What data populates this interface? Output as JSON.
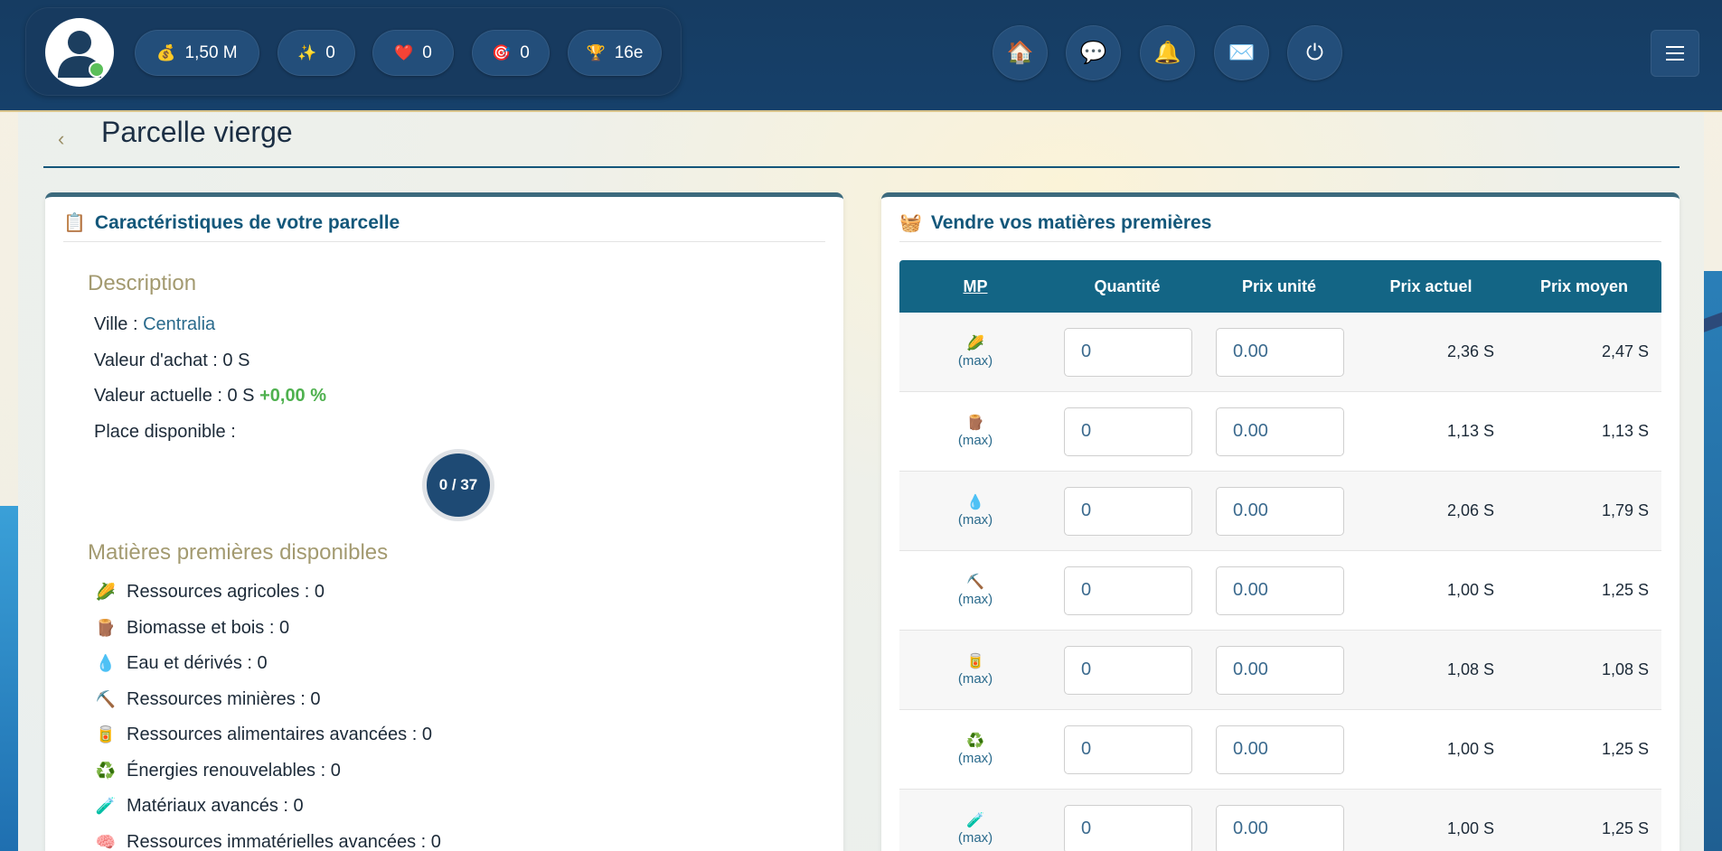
{
  "stats": [
    {
      "icon": "money-bag-icon",
      "glyph": "💰",
      "value": "1,50 M"
    },
    {
      "icon": "sparkles-icon",
      "glyph": "✨",
      "value": "0"
    },
    {
      "icon": "heart-icon",
      "glyph": "❤️",
      "value": "0"
    },
    {
      "icon": "target-icon",
      "glyph": "🎯",
      "value": "0"
    },
    {
      "icon": "trophy-icon",
      "glyph": "🏆",
      "value": "16e"
    }
  ],
  "nav": [
    {
      "icon": "home-icon",
      "glyph": "🏠"
    },
    {
      "icon": "chat-icon",
      "glyph": "💬"
    },
    {
      "icon": "bell-icon",
      "glyph": "🔔"
    },
    {
      "icon": "mail-icon",
      "glyph": "✉️"
    },
    {
      "icon": "power-icon",
      "glyph": "⏻"
    }
  ],
  "header": {
    "back": "‹",
    "title": "Parcelle vierge"
  },
  "left": {
    "heading_icon": "📋",
    "heading": "Caractéristiques de votre parcelle",
    "description_title": "Description",
    "ville_label": "Ville : ",
    "ville_value": "Centralia",
    "achat": "Valeur d'achat : 0 S",
    "actuelle_label": "Valeur actuelle : 0 S ",
    "actuelle_pct": "+0,00 %",
    "place": "Place disponible :",
    "capacity": "0 / 37",
    "mp_title": "Matières premières disponibles",
    "mp": [
      {
        "glyph": "🌽",
        "label": "Ressources agricoles : 0"
      },
      {
        "glyph": "🪵",
        "label": "Biomasse et bois : 0"
      },
      {
        "glyph": "💧",
        "label": "Eau et dérivés : 0"
      },
      {
        "glyph": "⛏️",
        "label": "Ressources minières : 0"
      },
      {
        "glyph": "🥫",
        "label": "Ressources alimentaires avancées : 0"
      },
      {
        "glyph": "♻️",
        "label": "Énergies renouvelables : 0"
      },
      {
        "glyph": "🧪",
        "label": "Matériaux avancés : 0"
      },
      {
        "glyph": "🧠",
        "label": "Ressources immatérielles avancées : 0"
      }
    ]
  },
  "right": {
    "heading_icon": "🧺",
    "heading": "Vendre vos matières premières",
    "columns": [
      "MP",
      "Quantité",
      "Prix unité",
      "Prix actuel",
      "Prix moyen"
    ],
    "rows": [
      {
        "glyph": "🌽",
        "max": "(max)",
        "qty": "0",
        "unit": "0.00",
        "actuel": "2,36 S",
        "moyen": "2,47 S"
      },
      {
        "glyph": "🪵",
        "max": "(max)",
        "qty": "0",
        "unit": "0.00",
        "actuel": "1,13 S",
        "moyen": "1,13 S"
      },
      {
        "glyph": "💧",
        "max": "(max)",
        "qty": "0",
        "unit": "0.00",
        "actuel": "2,06 S",
        "moyen": "1,79 S"
      },
      {
        "glyph": "⛏️",
        "max": "(max)",
        "qty": "0",
        "unit": "0.00",
        "actuel": "1,00 S",
        "moyen": "1,25 S"
      },
      {
        "glyph": "🥫",
        "max": "(max)",
        "qty": "0",
        "unit": "0.00",
        "actuel": "1,08 S",
        "moyen": "1,08 S"
      },
      {
        "glyph": "♻️",
        "max": "(max)",
        "qty": "0",
        "unit": "0.00",
        "actuel": "1,00 S",
        "moyen": "1,25 S"
      },
      {
        "glyph": "🧪",
        "max": "(max)",
        "qty": "0",
        "unit": "0.00",
        "actuel": "1,00 S",
        "moyen": "1,25 S"
      }
    ]
  }
}
